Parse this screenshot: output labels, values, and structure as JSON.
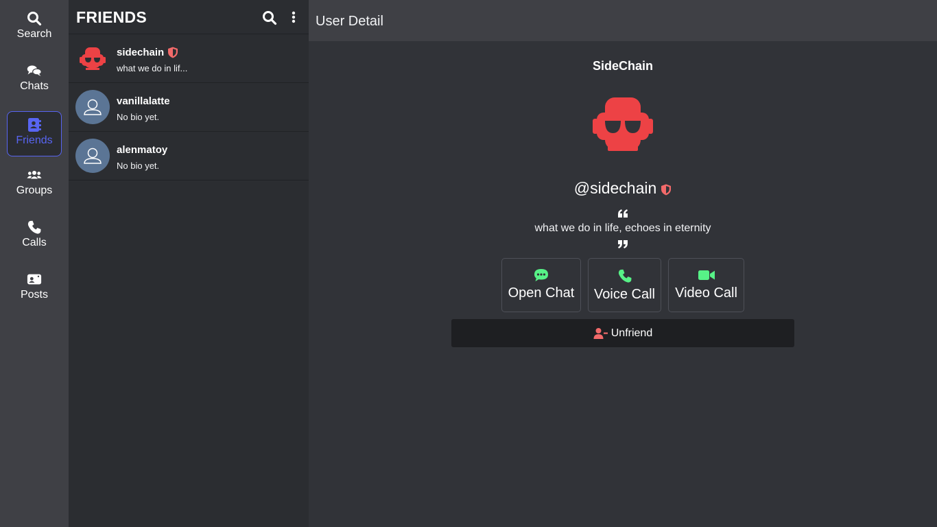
{
  "nav": {
    "items": [
      {
        "label": "Search",
        "icon": "search-icon"
      },
      {
        "label": "Chats",
        "icon": "chat-bubbles-icon"
      },
      {
        "label": "Friends",
        "icon": "address-book-icon",
        "active": true
      },
      {
        "label": "Groups",
        "icon": "users-icon"
      },
      {
        "label": "Calls",
        "icon": "phone-icon"
      },
      {
        "label": "Posts",
        "icon": "posts-icon"
      }
    ],
    "active_color": "#5865f2"
  },
  "friends_panel": {
    "title": "FRIENDS",
    "friends": [
      {
        "username": "sidechain",
        "bio": "what we do in lif...",
        "verified": true,
        "avatar": "robot-avatar"
      },
      {
        "username": "vanillalatte",
        "bio": "No bio yet.",
        "verified": false,
        "avatar": "default-avatar"
      },
      {
        "username": "alenmatoy",
        "bio": "No bio yet.",
        "verified": false,
        "avatar": "default-avatar"
      }
    ]
  },
  "detail": {
    "header_title": "User Detail",
    "display_name": "SideChain",
    "handle": "@sidechain",
    "bio": "what we do in life, echoes in eternity",
    "actions": {
      "open_chat": "Open Chat",
      "voice_call": "Voice Call",
      "video_call": "Video Call"
    },
    "unfriend_label": "Unfriend"
  },
  "colors": {
    "verified": "#f26a6a",
    "avatar_red": "#ed4245",
    "action_green": "#57f287"
  }
}
